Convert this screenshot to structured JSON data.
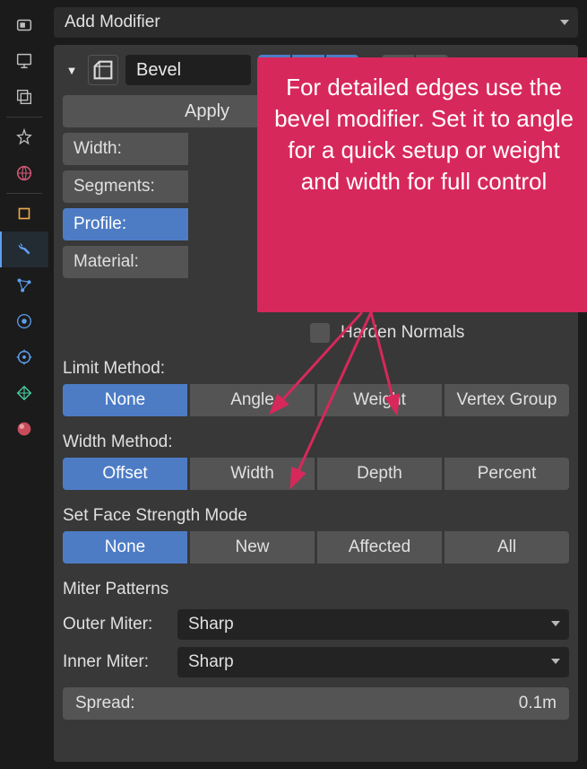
{
  "header": {
    "add_modifier": "Add Modifier"
  },
  "modifier": {
    "name": "Bevel",
    "apply_label": "Apply",
    "fields": {
      "width_label": "Width:",
      "segments_label": "Segments:",
      "profile_label": "Profile:",
      "material_label": "Material:"
    },
    "harden_normals_label": "Harden Normals",
    "limit_method": {
      "label": "Limit Method:",
      "options": [
        "None",
        "Angle",
        "Weight",
        "Vertex Group"
      ],
      "selected": "None"
    },
    "width_method": {
      "label": "Width Method:",
      "options": [
        "Offset",
        "Width",
        "Depth",
        "Percent"
      ],
      "selected": "Offset"
    },
    "face_strength": {
      "label": "Set Face Strength Mode",
      "options": [
        "None",
        "New",
        "Affected",
        "All"
      ],
      "selected": "None"
    },
    "miter": {
      "title": "Miter Patterns",
      "outer_label": "Outer Miter:",
      "outer_value": "Sharp",
      "inner_label": "Inner Miter:",
      "inner_value": "Sharp"
    },
    "spread": {
      "label": "Spread:",
      "value": "0.1m"
    }
  },
  "callout": {
    "text": "For detailed edges use the bevel modifier. Set it to angle for a quick setup or weight and width for full control"
  },
  "icons": {
    "rail": [
      "render",
      "output",
      "layers",
      "drop",
      "world",
      "cube",
      "wrench",
      "path",
      "circle",
      "target",
      "butterfly",
      "sphere"
    ]
  }
}
